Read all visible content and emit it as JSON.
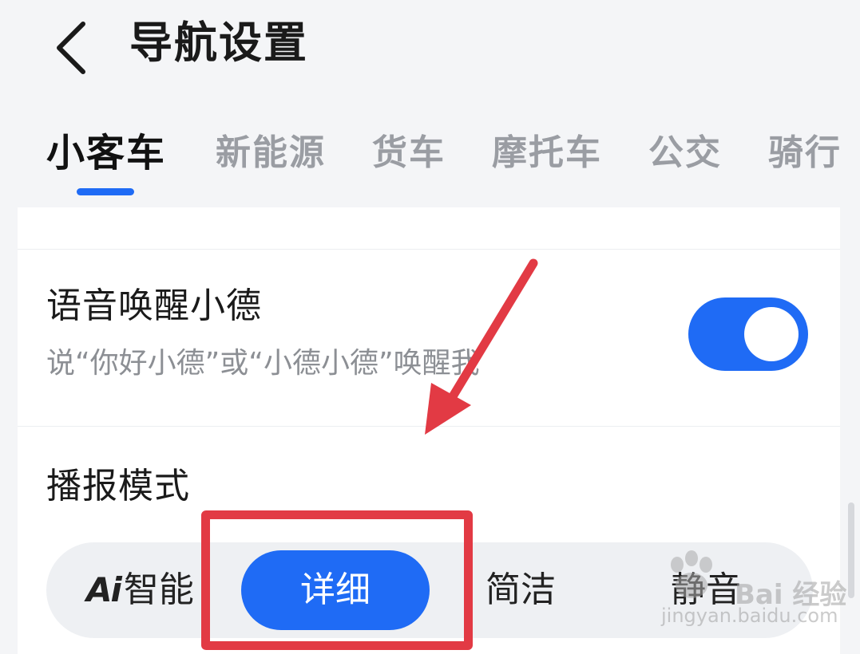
{
  "header": {
    "title": "导航设置",
    "back_icon": "chevron-left-icon"
  },
  "tabs": [
    {
      "label": "小客车",
      "active": true
    },
    {
      "label": "新能源",
      "active": false
    },
    {
      "label": "货车",
      "active": false
    },
    {
      "label": "摩托车",
      "active": false
    },
    {
      "label": "公交",
      "active": false
    },
    {
      "label": "骑行",
      "active": false
    }
  ],
  "settings": {
    "voice_wake": {
      "title": "语音唤醒小德",
      "description": "说“你好小德”或“小德小德”唤醒我",
      "enabled": true
    },
    "broadcast_mode": {
      "title": "播报模式",
      "options": [
        {
          "label": "智能",
          "icon_text": "Ai",
          "selected": false
        },
        {
          "label": "详细",
          "selected": true
        },
        {
          "label": "简洁",
          "selected": false
        },
        {
          "label": "静音",
          "selected": false
        }
      ]
    }
  },
  "watermark": {
    "text": "Bai 经验",
    "url": "jingyan.baidu.com"
  },
  "colors": {
    "accent": "#1f6bf5",
    "annotation": "#e23a44"
  }
}
